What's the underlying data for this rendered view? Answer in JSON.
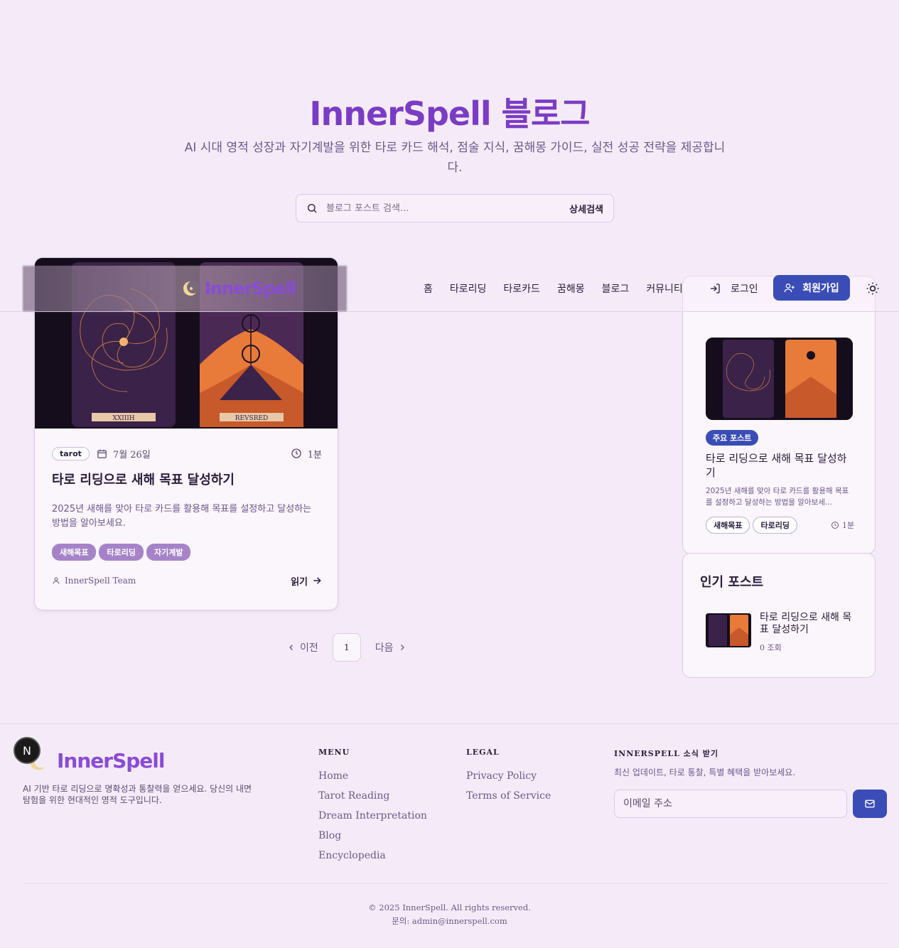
{
  "hero": {
    "title": "InnerSpell 블로그",
    "subtitle": "AI 시대 영적 성장과 자기계발을 위한 타로 카드 해석, 점술 지식, 꿈해몽 가이드, 실전 성공 전략을 제공합니다.",
    "search_placeholder": "블로그 포스트 검색...",
    "advanced_search": "상세검색"
  },
  "header": {
    "logo": "InnerSpell",
    "nav": [
      "홈",
      "타로리딩",
      "타로카드",
      "꿈해몽",
      "블로그",
      "커뮤니티"
    ],
    "login": "로그인",
    "signup": "회원가입"
  },
  "post": {
    "category": "tarot",
    "date": "7월 26일",
    "read_time": "1분",
    "title": "타로 리딩으로 새해 목표 달성하기",
    "excerpt": "2025년 새해를 맞아 타로 카드를 활용해 목표를 설정하고 달성하는 방법을 알아보세요.",
    "tags": [
      "새해목표",
      "타로리딩",
      "자기계발"
    ],
    "author": "InnerSpell Team",
    "read_more": "읽기",
    "card_labels": [
      "XXIIIH",
      "REVSRED"
    ]
  },
  "pagination": {
    "prev": "이전",
    "current": "1",
    "next": "다음"
  },
  "sidebar": {
    "featured": {
      "badge": "주요 포스트",
      "title": "타로 리딩으로 새해 목표 달성하기",
      "excerpt": "2025년 새해를 맞아 타로 카드를 활용해 목표를 설정하고 달성하는 방법을 알아보세...",
      "tags": [
        "새해목표",
        "타로리딩"
      ],
      "read_time": "1분"
    },
    "popular": {
      "heading": "인기 포스트",
      "title": "타로 리딩으로 새해 목표 달성하기",
      "views": "0 조회"
    }
  },
  "footer": {
    "logo": "InnerSpell",
    "about": "AI 기반 타로 리딩으로 명확성과 통찰력을 얻으세요. 당신의 내면 탐험을 위한 현대적인 영적 도구입니다.",
    "menu_heading": "MENU",
    "menu": [
      "Home",
      "Tarot Reading",
      "Dream Interpretation",
      "Blog",
      "Encyclopedia"
    ],
    "legal_heading": "LEGAL",
    "legal": [
      "Privacy Policy",
      "Terms of Service"
    ],
    "newsletter_heading": "INNERSPELL 소식 받기",
    "newsletter_desc": "최신 업데이트, 타로 통찰, 특별 혜택을 받아보세요.",
    "email_placeholder": "이메일 주소",
    "copyright": "© 2025 InnerSpell. All rights reserved.",
    "contact": "문의: admin@innerspell.com"
  },
  "dev_badge": "N",
  "colors": {
    "accent": "#7a3cc4",
    "primary_button": "#3a4db7",
    "tag": "#a683c9",
    "background": "#f5ebf8"
  }
}
